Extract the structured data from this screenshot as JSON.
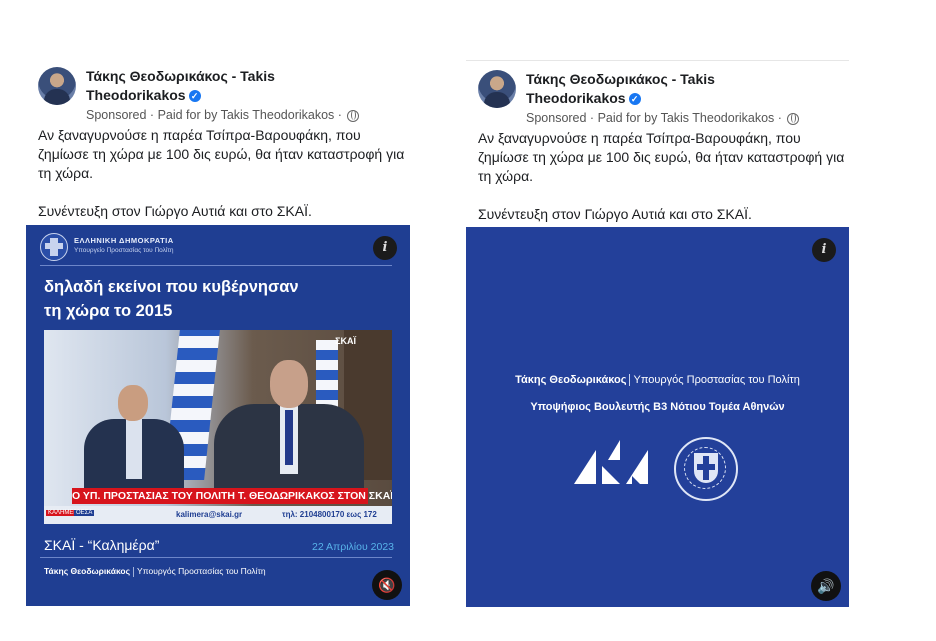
{
  "posts": [
    {
      "author_line1": "Τάκης Θεοδωρικάκος - Takis",
      "author_line2": "Theodorikakos",
      "verified_icon": "✓",
      "meta": "Sponsored · Paid for by Takis Theodorikakos ·",
      "body_line1": "Αν ξαναγυρνούσε η παρέα Τσίπρα-Βαρουφάκη, που ζημίωσε τη χώρα με 100 δις ευρώ, θα ήταν καταστροφή για τη χώρα.",
      "body_line2": "Συνέντευξη στον Γιώργο Αυτιά και στο ΣΚΑΪ.",
      "video": {
        "gov_title": "ΕΛΛΗΝΙΚΗ ΔΗΜΟΚΡΑΤΙΑ",
        "gov_subtitle": "Υπουργείο Προστασίας του Πολίτη",
        "headline_1": "δηλαδή εκείνοι που κυβέρνησαν",
        "headline_2": "τη χώρα το 2015",
        "channel_mark": "ΣΚΑΪ",
        "ticker": "Ο ΥΠ. ΠΡΟΣΤΑΣΙΑΣ ΤΟΥ ΠΟΛΙΤΗ Τ. ΘΕΟΔΩΡΙΚΑΚΟΣ ΣΤΟΝ ΣΚΑΪ",
        "ticker_tag": "ΚΑΛΗΜΕΡΑ",
        "ticker_tag2": "ΟΕΣΑ",
        "ticker_email": "kalimera@skai.gr",
        "ticker_tel": "τηλ: 2104800170 εως 172",
        "source": "ΣΚΑΪ - “Καλημέρα”",
        "date": "22 Απριλίου 2023",
        "footer_name": "Τάκης Θεοδωρικάκος",
        "footer_role": "Υπουργός Προστασίας του Πολίτη",
        "info_icon": "i",
        "sound_icon": "🔇"
      }
    },
    {
      "author_line1": "Τάκης Θεοδωρικάκος - Takis",
      "author_line2": "Theodorikakos",
      "verified_icon": "✓",
      "meta": "Sponsored · Paid for by Takis Theodorikakos ·",
      "body_line1": "Αν ξαναγυρνούσε η παρέα Τσίπρα-Βαρουφάκη, που ζημίωσε τη χώρα με 100 δις ευρώ, θα ήταν καταστροφή για τη χώρα.",
      "body_line2": "Συνέντευξη στον Γιώργο Αυτιά και στο ΣΚΑΪ.",
      "video": {
        "name": "Τάκης Θεοδωρικάκος",
        "role": "Υπουργός Προστασίας του Πολίτη",
        "candidacy": "Υποψήφιος Βουλευτής Β3 Νότιου Τομέα Αθηνών",
        "info_icon": "i",
        "sound_icon": "🔊"
      }
    }
  ],
  "colors": {
    "video_bg": "#1f3e92",
    "ticker_red": "#d7141c",
    "date_blue": "#58b3ea",
    "verified_blue": "#1877f2"
  }
}
